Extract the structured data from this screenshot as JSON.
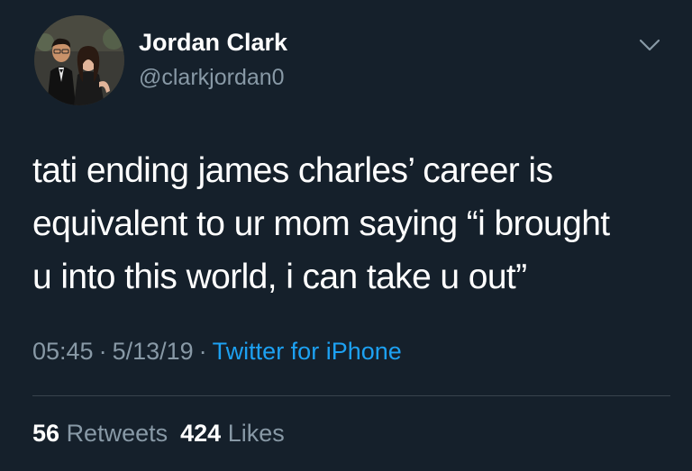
{
  "author": {
    "name": "Jordan Clark",
    "handle": "@clarkjordan0",
    "avatar_icon": "profile-photo"
  },
  "menu": {
    "icon": "chevron-down-icon"
  },
  "tweet": {
    "lines": [
      "tati ending james charles’ career is",
      "equivalent to ur mom saying “i brought",
      "u into this world, i can take u out”"
    ]
  },
  "meta": {
    "time": "05:45",
    "separator": "·",
    "date": "5/13/19",
    "source": "Twitter for iPhone"
  },
  "stats": {
    "retweets_count": "56",
    "retweets_label": "Retweets",
    "likes_count": "424",
    "likes_label": "Likes"
  },
  "colors": {
    "background": "#15202b",
    "text": "#ffffff",
    "secondary": "#8899a6",
    "link": "#1da1f2",
    "divider": "#38444d"
  }
}
